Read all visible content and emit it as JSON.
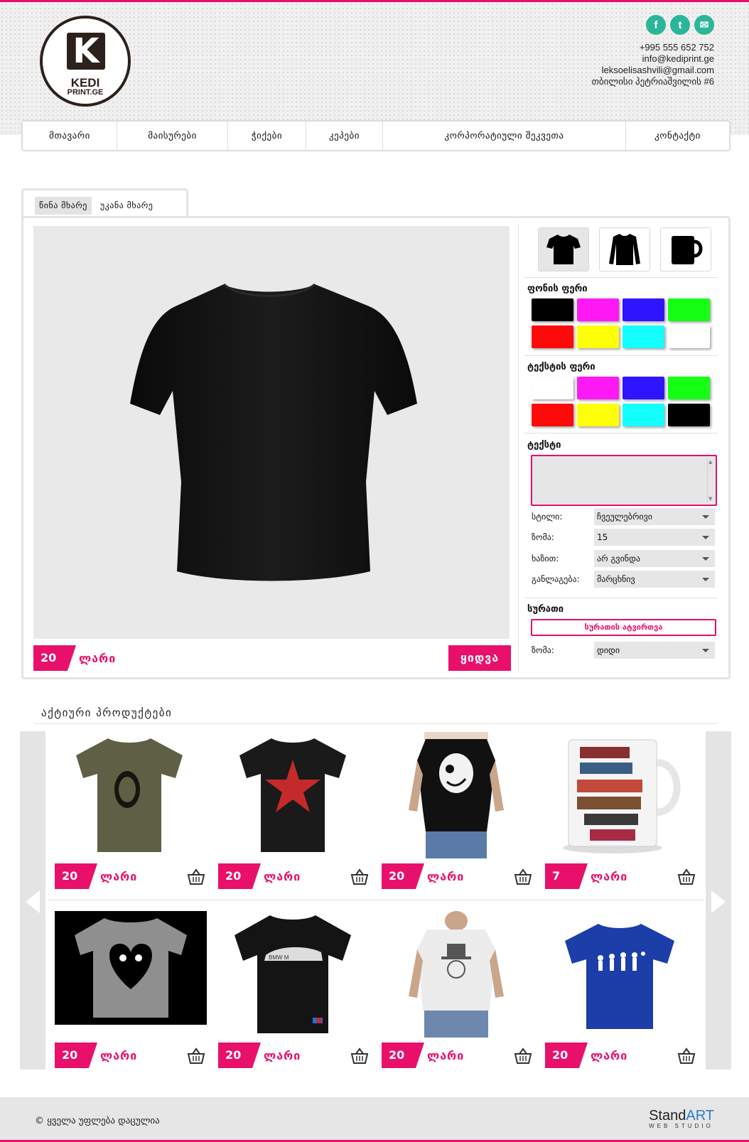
{
  "brand": {
    "logo_letter": "K",
    "logo_line1": "KEDI",
    "logo_line2": "PRINT.GE"
  },
  "contact": {
    "phone": "+995 555 652 752",
    "email1": "info@kediprint.ge",
    "email2": "leksoelisashvili@gmail.com",
    "address": "თბილისი პეტრიაშვილის #6"
  },
  "social": {
    "facebook": "f",
    "twitter": "t",
    "mail": "✉"
  },
  "nav": [
    {
      "label": "მთავარი"
    },
    {
      "label": "მაისურები"
    },
    {
      "label": "ჭიქები"
    },
    {
      "label": "კეპები"
    },
    {
      "label": "კორპორატიული შეკვეთა"
    },
    {
      "label": "კონტაქტი"
    }
  ],
  "tabs": {
    "front": "წინა მხარე",
    "back": "უკანა მხარე",
    "active": "front"
  },
  "designer": {
    "price": "20",
    "currency": "ლარი",
    "buy_label": "ყიდვა",
    "product_types": [
      "tshirt-icon",
      "longsleeve-icon",
      "mug-icon"
    ],
    "bg_color_title": "ფონის ფერი",
    "bg_colors": [
      "#000000",
      "#ff1af5",
      "#2f14ff",
      "#14ff14",
      "#ff0a0a",
      "#ffff0a",
      "#14ffff",
      "#ffffff"
    ],
    "text_color_title": "ტექსტის ფერი",
    "text_colors": [
      "#ffffff",
      "#ff1af5",
      "#2f14ff",
      "#14ff14",
      "#ff0a0a",
      "#ffff0a",
      "#14ffff",
      "#000000"
    ],
    "text_title": "ტექსტი",
    "text_value": "",
    "fields": [
      {
        "label": "სტილი:",
        "value": "ჩვეულებრივი"
      },
      {
        "label": "ზომა:",
        "value": "15"
      },
      {
        "label": "ხაზით:",
        "value": "არ გვინდა"
      },
      {
        "label": "განლაგება:",
        "value": "მარცხნივ"
      }
    ],
    "image_title": "სურათი",
    "upload_label": "სურათის ატვირთვა",
    "image_size_label": "ზომა:",
    "image_size_value": "დიდი"
  },
  "active_products": {
    "title": "აქტიური პროდუქტები",
    "items": [
      {
        "price": "20",
        "currency": "ლარი",
        "image": "olive-tshirt-dali"
      },
      {
        "price": "20",
        "currency": "ლარი",
        "image": "black-tshirt-red-star"
      },
      {
        "price": "20",
        "currency": "ლარი",
        "image": "black-tshirt-joker"
      },
      {
        "price": "7",
        "currency": "ლარი",
        "image": "mug-coffee"
      },
      {
        "price": "20",
        "currency": "ლარი",
        "image": "grey-tshirt-heart"
      },
      {
        "price": "20",
        "currency": "ლარი",
        "image": "black-tshirt-bmw"
      },
      {
        "price": "20",
        "currency": "ლარი",
        "image": "white-tshirt-hat"
      },
      {
        "price": "20",
        "currency": "ლარი",
        "image": "blue-tshirt-evolution"
      }
    ]
  },
  "footer": {
    "copyright": "© ყველა უფლება დაცულია",
    "studio_a": "Stand",
    "studio_b": "ART",
    "studio_c": "WEB STUDIO"
  },
  "colors": {
    "accent": "#e8106a",
    "social": "#2bb59a"
  }
}
